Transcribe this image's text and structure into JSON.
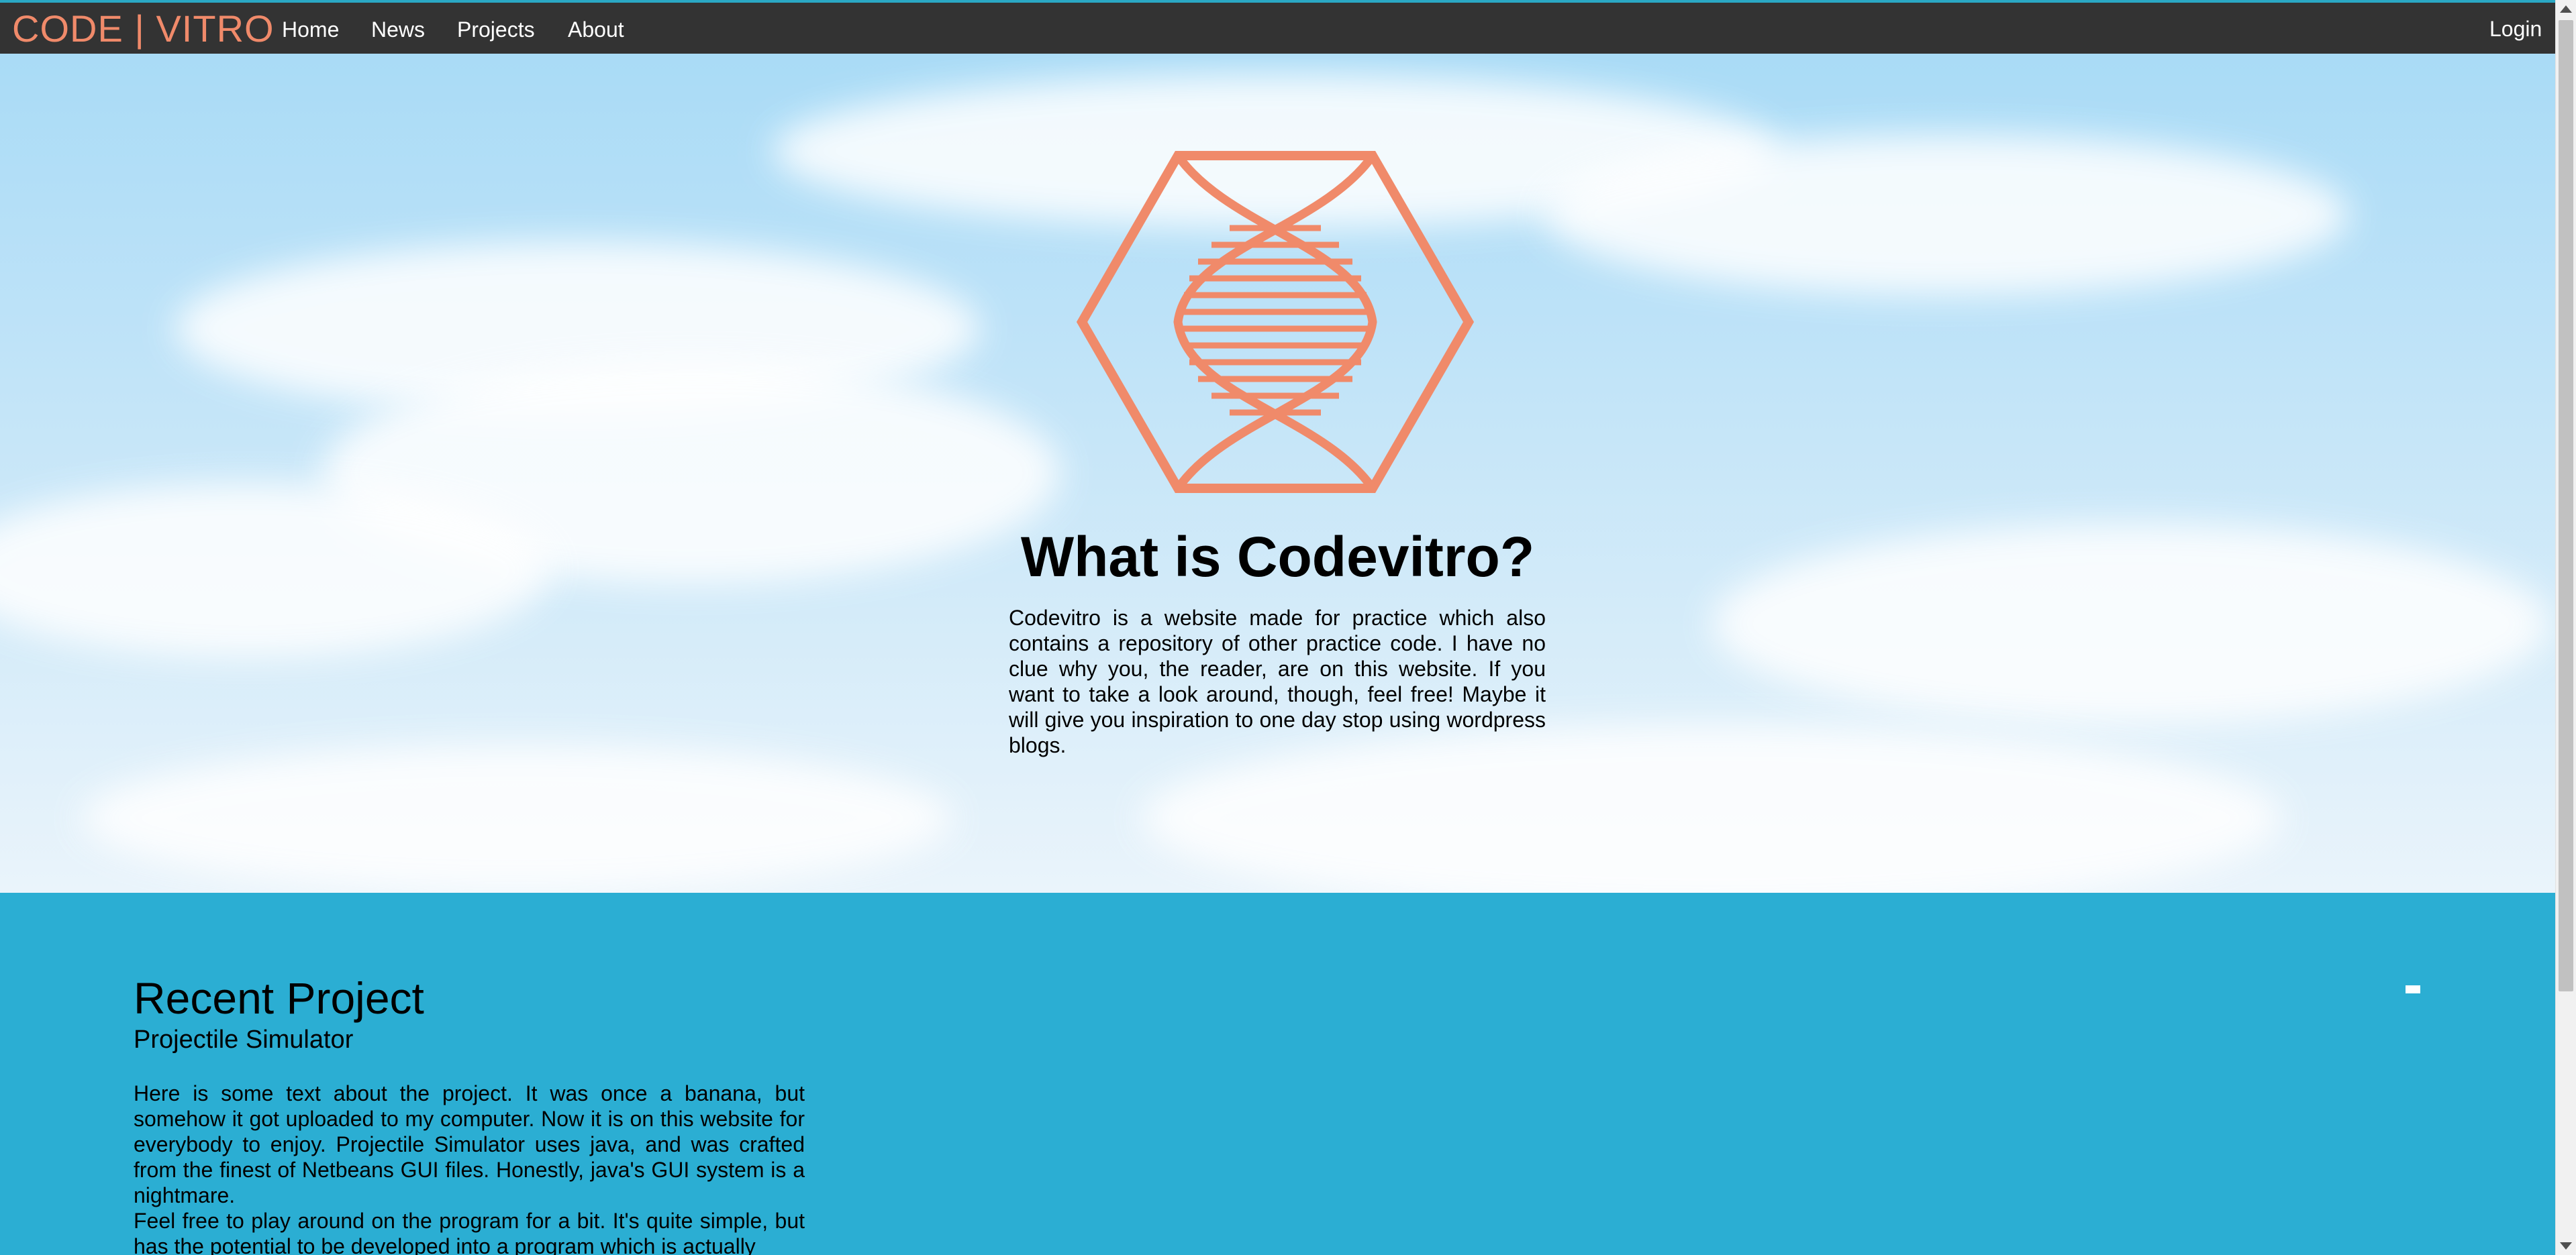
{
  "nav": {
    "brand": "CODE | VITRO",
    "links": [
      "Home",
      "News",
      "Projects",
      "About"
    ],
    "login": "Login"
  },
  "hero": {
    "logo_icon": "dna-hexagon-logo",
    "title": "What is Codevitro?",
    "description": "Codevitro is a website made for practice which also contains a repository of other practice code. I have no clue why you, the reader, are on this website. If you want to take a look around, though, feel free! Maybe it will give you inspiration to one day stop using wordpress blogs."
  },
  "recent_project": {
    "heading": "Recent Project",
    "project_name": "Projectile Simulator",
    "paragraphs": [
      "Here is some text about the project. It was once a banana, but somehow it got uploaded to my computer. Now it is on this website for everybody to enjoy. Projectile Simulator uses java, and was crafted from the finest of Netbeans GUI files. Honestly, java's GUI system is a nightmare.",
      "Feel free to play around on the program for a bit. It's quite simple, but has the potential to be developed into a program which is actually"
    ]
  },
  "colors": {
    "accent": "#f08a6a",
    "navbar": "#333333",
    "section_bg": "#2baed3",
    "nav_text": "#ffffff"
  }
}
